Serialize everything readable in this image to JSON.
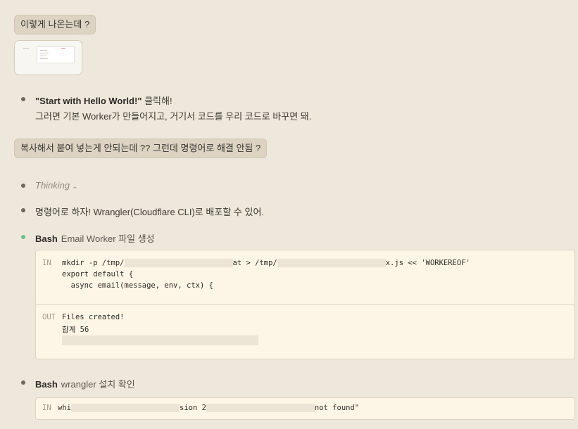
{
  "messages": {
    "user1": "이렇게 나온는데 ?",
    "user2": "복사해서 붙여 넣는게 안되는데 ?? 그런데 명령어로 해결 안됨 ?"
  },
  "assistant": {
    "step1_bold": "\"Start with Hello World!\"",
    "step1_rest": " 클릭해!",
    "step1_line2": "그러면 기본 Worker가 만들어지고, 거기서 코드를 우리 코드로 바꾸면 돼.",
    "thinking_label": "Thinking",
    "proposal": "명령어로 하자! Wrangler(Cloudflare CLI)로 배포할 수 있어."
  },
  "tools": [
    {
      "name": "Bash",
      "description": "Email Worker 파일 생성",
      "in_tag": "IN",
      "in_lines": {
        "l1_a": "mkdir -p /tmp/",
        "l1_b": "at > /tmp/",
        "l1_c": "x.js << 'WORKEREOF'",
        "l2": "export default {",
        "l3": "  async email(message, env, ctx) {"
      },
      "out_tag": "OUT",
      "out_lines": {
        "l1": "Files created!",
        "l2": "합계 56"
      }
    },
    {
      "name": "Bash",
      "description": "wrangler 설치 확인",
      "in_tag": "IN",
      "in_lines": {
        "a": "whi",
        "b": "sion 2",
        "c": "not found\""
      }
    }
  ],
  "icons": {
    "bullet": "bullet-dot-icon",
    "active_bullet": "status-dot-icon",
    "chevron": "chevron-down-icon"
  },
  "colors": {
    "background": "#eee8dc",
    "bubble": "#dcd3c3",
    "code_bg": "#fdf6e6",
    "active": "#6fbf8d"
  }
}
